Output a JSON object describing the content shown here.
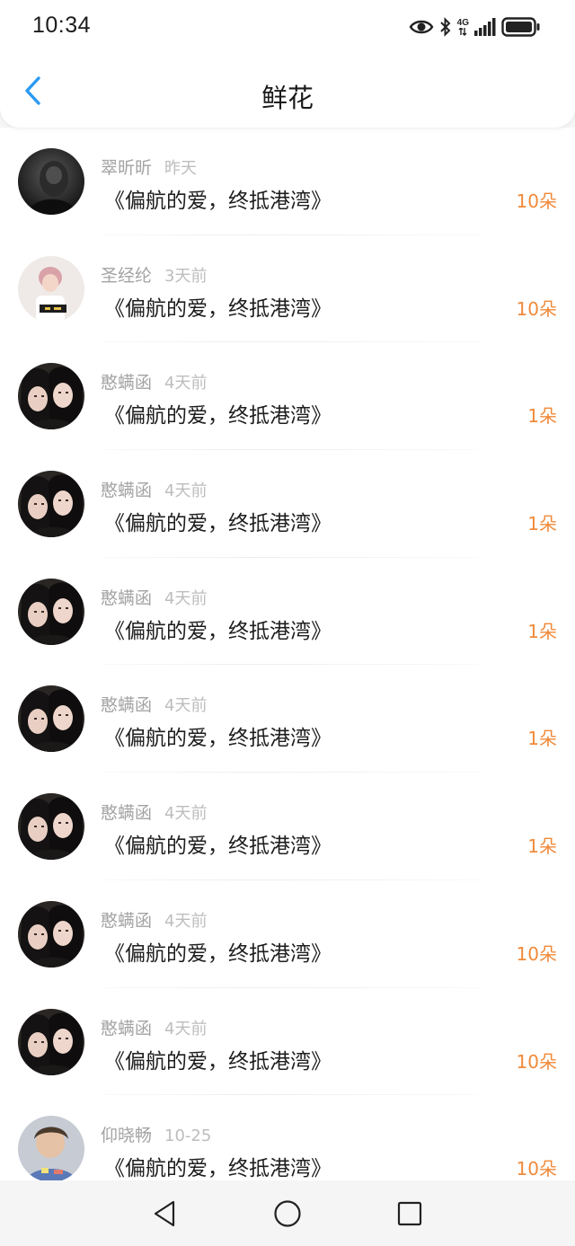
{
  "status_bar": {
    "time": "10:34",
    "network_label": "4G",
    "icons": [
      "eye-icon",
      "bluetooth-icon",
      "signal-icon",
      "battery-icon"
    ]
  },
  "header": {
    "title": "鲜花",
    "back_icon": "chevron-left-icon"
  },
  "colors": {
    "accent_blue": "#2a9af3",
    "count_orange": "#f08a3a",
    "name_gray": "#a3a3a3",
    "time_gray": "#bdbdbd"
  },
  "list": {
    "items": [
      {
        "name": "翠昕昕",
        "time": "昨天",
        "book": "《偏航的爱，终抵港湾》",
        "count": "10朵",
        "avatar": "dark-hooded"
      },
      {
        "name": "圣经纶",
        "time": "3天前",
        "book": "《偏航的爱，终抵港湾》",
        "count": "10朵",
        "avatar": "light-figure"
      },
      {
        "name": "憨螨函",
        "time": "4天前",
        "book": "《偏航的爱，终抵港湾》",
        "count": "1朵",
        "avatar": "couple"
      },
      {
        "name": "憨螨函",
        "time": "4天前",
        "book": "《偏航的爱，终抵港湾》",
        "count": "1朵",
        "avatar": "couple"
      },
      {
        "name": "憨螨函",
        "time": "4天前",
        "book": "《偏航的爱，终抵港湾》",
        "count": "1朵",
        "avatar": "couple"
      },
      {
        "name": "憨螨函",
        "time": "4天前",
        "book": "《偏航的爱，终抵港湾》",
        "count": "1朵",
        "avatar": "couple"
      },
      {
        "name": "憨螨函",
        "time": "4天前",
        "book": "《偏航的爱，终抵港湾》",
        "count": "1朵",
        "avatar": "couple"
      },
      {
        "name": "憨螨函",
        "time": "4天前",
        "book": "《偏航的爱，终抵港湾》",
        "count": "10朵",
        "avatar": "couple"
      },
      {
        "name": "憨螨函",
        "time": "4天前",
        "book": "《偏航的爱，终抵港湾》",
        "count": "10朵",
        "avatar": "couple"
      },
      {
        "name": "仰晓畅",
        "time": "10-25",
        "book": "《偏航的爱，终抵港湾》",
        "count": "10朵",
        "avatar": "child"
      }
    ]
  },
  "nav_bar": {
    "icons": [
      "back-triangle-icon",
      "home-circle-icon",
      "recents-square-icon"
    ]
  }
}
